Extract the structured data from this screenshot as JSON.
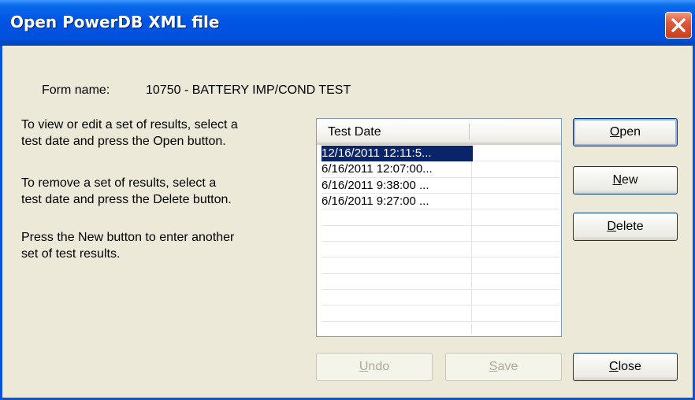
{
  "window": {
    "title": "Open PowerDB XML file"
  },
  "form": {
    "label": "Form name:",
    "value": "10750 - BATTERY IMP/COND TEST"
  },
  "instructions": [
    {
      "lines": [
        "To view or edit a set of results, select a",
        "test date and press the Open button."
      ]
    },
    {
      "lines": [
        "To remove a set of results, select a",
        "test date and press the Delete button."
      ]
    },
    {
      "lines": [
        "Press the New button to enter another",
        "set of test results."
      ]
    }
  ],
  "list": {
    "column_header": "Test Date",
    "rows": [
      {
        "label": "12/16/2011 12:11:5...",
        "selected": true
      },
      {
        "label": "6/16/2011 12:07:00...",
        "selected": false
      },
      {
        "label": "6/16/2011 9:38:00 ...",
        "selected": false
      },
      {
        "label": "6/16/2011 9:27:00 ...",
        "selected": false
      }
    ]
  },
  "buttons": {
    "open": {
      "mnemonic": "O",
      "rest": "pen"
    },
    "new": {
      "mnemonic": "N",
      "rest": "ew"
    },
    "delete": {
      "mnemonic": "D",
      "rest": "elete"
    },
    "undo": {
      "mnemonic": "U",
      "rest": "ndo"
    },
    "save": {
      "mnemonic": "S",
      "rest": "ave"
    },
    "close": {
      "mnemonic": "C",
      "rest": "lose"
    }
  },
  "icons": {
    "close": "close-x-icon"
  },
  "colors": {
    "titlebar": "#0054E3",
    "dialog_bg": "#ECE9D8",
    "selection": "#0A246A",
    "close_button": "#E0583A"
  }
}
